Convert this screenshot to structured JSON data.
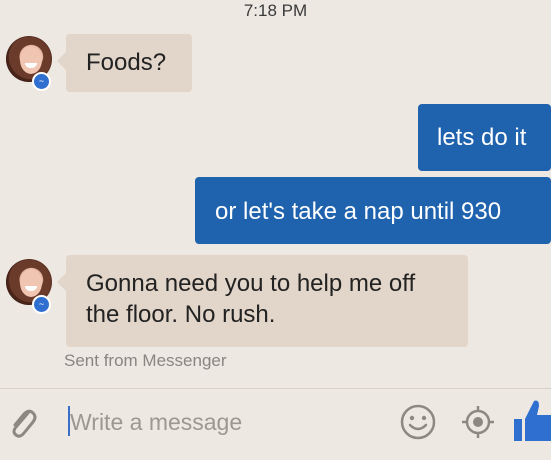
{
  "status_bar": {
    "time": "7:18 PM"
  },
  "messages": [
    {
      "direction": "incoming",
      "text": "Foods?"
    },
    {
      "direction": "outgoing",
      "text": "lets do it"
    },
    {
      "direction": "outgoing",
      "text": "or let's take a nap until 930"
    },
    {
      "direction": "incoming",
      "lines": [
        "Gonna need you to help me off",
        "the floor. No rush."
      ]
    }
  ],
  "footer_note": "Sent from Messenger",
  "composer": {
    "placeholder": "Write a message",
    "icons": [
      "paperclip-icon",
      "smiley-icon",
      "location-icon",
      "thumbs-up-icon"
    ]
  },
  "colors": {
    "background": "#ede8e2",
    "incoming_bubble": "#e2d5c9",
    "outgoing_bubble": "#1f62ad",
    "accent": "#2f6fcf"
  }
}
